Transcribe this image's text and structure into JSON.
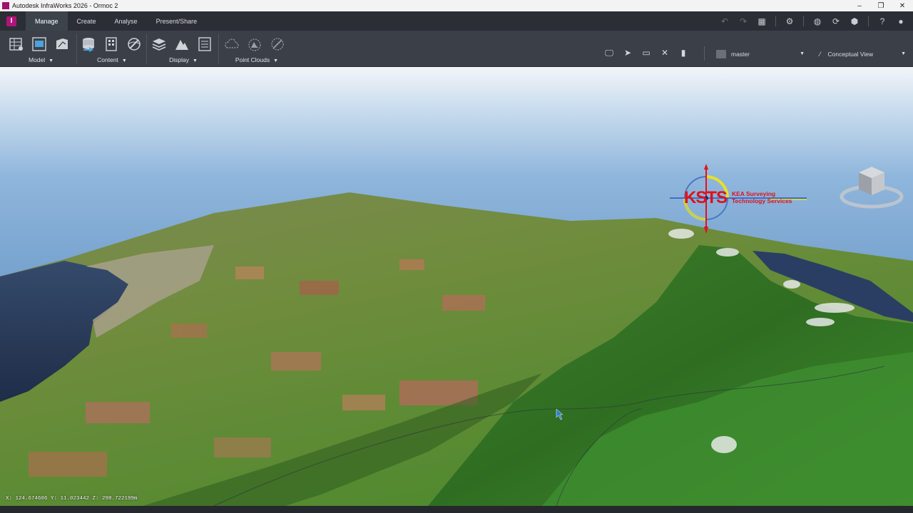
{
  "window": {
    "title": "Autodesk InfraWorks 2026 - Ormoc 2",
    "minimize": "–",
    "maximize": "❐",
    "close": "✕"
  },
  "tabs": [
    {
      "label": "Manage",
      "active": true
    },
    {
      "label": "Create",
      "active": false
    },
    {
      "label": "Analyse",
      "active": false
    },
    {
      "label": "Present/Share",
      "active": false
    }
  ],
  "ribbon": {
    "panels": [
      {
        "label": "Model"
      },
      {
        "label": "Content"
      },
      {
        "label": "Display"
      },
      {
        "label": "Point Clouds"
      }
    ],
    "proposal_dropdown": {
      "value": "master"
    },
    "view_dropdown": {
      "value": "Conceptual View"
    }
  },
  "viewport": {
    "coordinates": "X: 124.674606 Y: 11.023442 Z: 298.722199m",
    "watermark": {
      "primary": "KSTS",
      "line1": "KEA Surveying",
      "line2": "Technology Services"
    }
  },
  "colors": {
    "accent": "#b0147a",
    "ribbon_bg": "#3b4048",
    "tab_bg": "#2b2e34",
    "watermark_red": "#e0111a"
  }
}
